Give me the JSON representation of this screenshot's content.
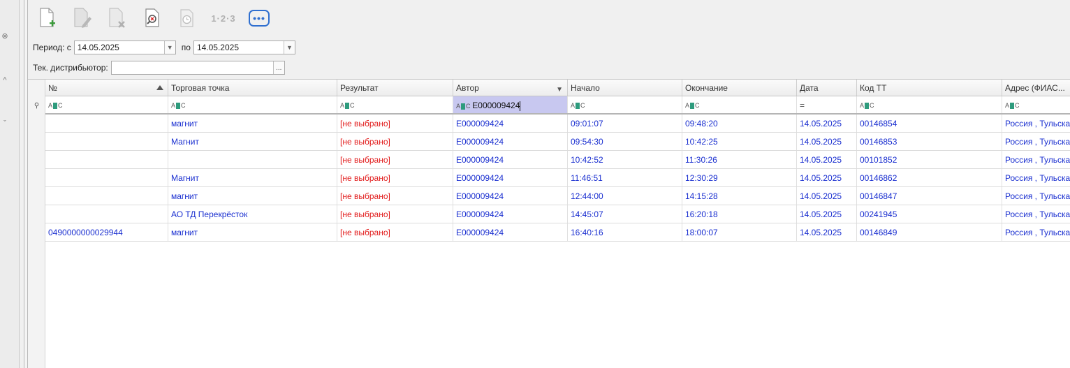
{
  "toolbar": {
    "add_icon": "new-document-plus-icon",
    "edit_icon": "edit-document-icon",
    "delete_icon": "delete-document-icon",
    "view_icon": "document-search-icon",
    "history_icon": "clock-icon",
    "numbering_label": "1·2·3",
    "more_label": "•••"
  },
  "filters": {
    "period_label": "Период: с",
    "date_from": "14.05.2025",
    "to_label": "по",
    "date_to": "14.05.2025",
    "distributor_label": "Тек. дистрибьютор:",
    "distributor_value": "",
    "ellipsis": "..."
  },
  "grid": {
    "columns": [
      "№",
      "Торговая точка",
      "Результат",
      "Автор",
      "Начало",
      "Окончание",
      "Дата",
      "Код ТТ",
      "Адрес (ФИАС..."
    ],
    "filter_row": {
      "author_filter": "E000009424",
      "date_filter_symbol": "="
    },
    "rows": [
      {
        "num": "",
        "outlet": "магнит",
        "result": "[не выбрано]",
        "author": "E000009424",
        "start": "09:01:07",
        "end": "09:48:20",
        "date": "14.05.2025",
        "code": "00146854",
        "address": "Россия , Тульская"
      },
      {
        "num": "",
        "outlet": "Магнит",
        "result": "[не выбрано]",
        "author": "E000009424",
        "start": "09:54:30",
        "end": "10:42:25",
        "date": "14.05.2025",
        "code": "00146853",
        "address": "Россия , Тульская"
      },
      {
        "num": "",
        "outlet": "",
        "result": "[не выбрано]",
        "author": "E000009424",
        "start": "10:42:52",
        "end": "11:30:26",
        "date": "14.05.2025",
        "code": "00101852",
        "address": "Россия , Тульская"
      },
      {
        "num": "",
        "outlet": "Магнит",
        "result": "[не выбрано]",
        "author": "E000009424",
        "start": "11:46:51",
        "end": "12:30:29",
        "date": "14.05.2025",
        "code": "00146862",
        "address": "Россия , Тульская"
      },
      {
        "num": "",
        "outlet": "магнит",
        "result": "[не выбрано]",
        "author": "E000009424",
        "start": "12:44:00",
        "end": "14:15:28",
        "date": "14.05.2025",
        "code": "00146847",
        "address": "Россия , Тульская"
      },
      {
        "num": "",
        "outlet": "АО ТД Перекрёсток",
        "result": "[не выбрано]",
        "author": "E000009424",
        "start": "14:45:07",
        "end": "16:20:18",
        "date": "14.05.2025",
        "code": "00241945",
        "address": "Россия , Тульская"
      },
      {
        "num": "0490000000029944",
        "outlet": "магнит",
        "result": "[не выбрано]",
        "author": "E000009424",
        "start": "16:40:16",
        "end": "18:00:07",
        "date": "14.05.2025",
        "code": "00146849",
        "address": "Россия , Тульская"
      }
    ]
  },
  "colors": {
    "data_text": "#1a2fd0",
    "result_text": "#e21b1b",
    "active_filter_bg": "#c8c8f0"
  }
}
